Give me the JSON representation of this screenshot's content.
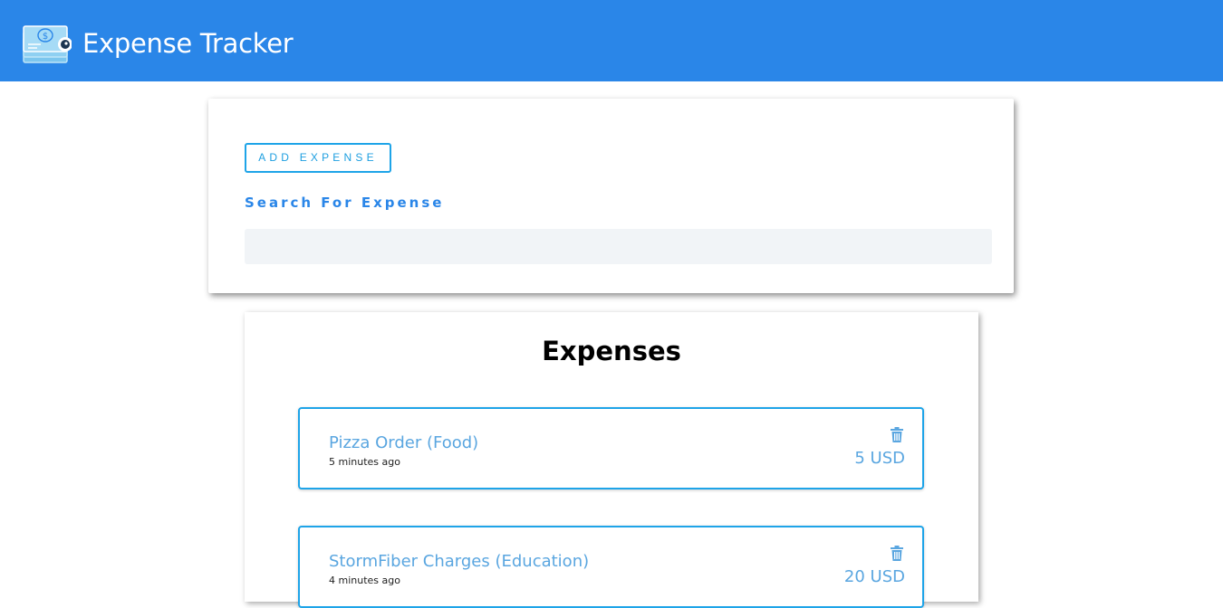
{
  "app": {
    "title": "Expense Tracker",
    "logo_icon": "money-stack-eye-icon",
    "header_color": "#2a86e8"
  },
  "form": {
    "add_button_label": "ADD EXPENSE",
    "search_label": "Search For Expense",
    "search_value": "",
    "search_placeholder": ""
  },
  "expenses": {
    "title": "Expenses",
    "items": [
      {
        "name": "Pizza Order (Food)",
        "time": "5 minutes ago",
        "amount": "5 USD",
        "delete_icon": "trash-icon"
      },
      {
        "name": "StormFiber Charges (Education)",
        "time": "4 minutes ago",
        "amount": "20 USD",
        "delete_icon": "trash-icon"
      }
    ]
  },
  "colors": {
    "accent": "#1ea4e8",
    "item_text": "#5aa6e0",
    "search_bg": "#f1f4f7"
  }
}
